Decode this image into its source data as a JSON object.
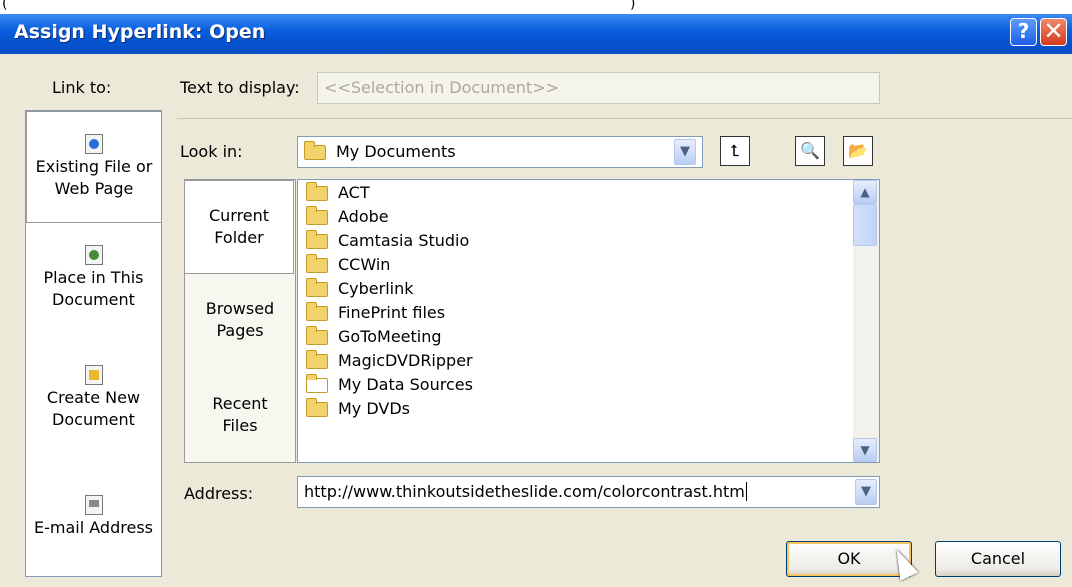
{
  "window": {
    "title": "Assign Hyperlink: Open",
    "help_glyph": "?",
    "close_glyph": "✕"
  },
  "top_fragment": {
    "left": "(",
    "right": ")"
  },
  "link_to": {
    "label": "Link to:",
    "items": [
      {
        "line1": "Existing File or",
        "line2": "Web Page",
        "icon": "web-page-icon",
        "selected": true
      },
      {
        "line1": "Place in This",
        "line2": "Document",
        "icon": "document-place-icon",
        "selected": false
      },
      {
        "line1": "Create New",
        "line2": "Document",
        "icon": "new-document-icon",
        "selected": false
      },
      {
        "line1": "E-mail Address",
        "line2": "",
        "icon": "email-icon",
        "selected": false
      }
    ]
  },
  "text_to_display": {
    "label": "Text to display:",
    "value": "<<Selection in Document>>"
  },
  "look_in": {
    "label": "Look in:",
    "value": "My Documents",
    "icon": "folder-icon"
  },
  "toolbar_icons": [
    "up-one-folder-icon",
    "browse-web-icon",
    "browse-file-icon"
  ],
  "tabs": [
    {
      "line1": "Current",
      "line2": "Folder",
      "selected": true
    },
    {
      "line1": "Browsed",
      "line2": "Pages",
      "selected": false
    },
    {
      "line1": "Recent",
      "line2": "Files",
      "selected": false
    }
  ],
  "files": [
    {
      "name": "ACT",
      "icon": "folder-icon"
    },
    {
      "name": "Adobe",
      "icon": "folder-icon"
    },
    {
      "name": "Camtasia Studio",
      "icon": "folder-icon"
    },
    {
      "name": "CCWin",
      "icon": "folder-icon"
    },
    {
      "name": "Cyberlink",
      "icon": "folder-icon"
    },
    {
      "name": "FinePrint files",
      "icon": "folder-icon"
    },
    {
      "name": "GoToMeeting",
      "icon": "folder-icon"
    },
    {
      "name": "MagicDVDRipper",
      "icon": "folder-icon"
    },
    {
      "name": "My Data Sources",
      "icon": "data-sources-folder-icon"
    },
    {
      "name": "My DVDs",
      "icon": "folder-icon"
    }
  ],
  "address": {
    "label": "Address:",
    "value": "http://www.thinkoutsidetheslide.com/colorcontrast.htm"
  },
  "buttons": {
    "ok": "OK",
    "cancel": "Cancel"
  },
  "colors": {
    "title_bar": "#0a5fde",
    "dialog_bg": "#ece9d8",
    "field_border": "#7f9db9"
  }
}
